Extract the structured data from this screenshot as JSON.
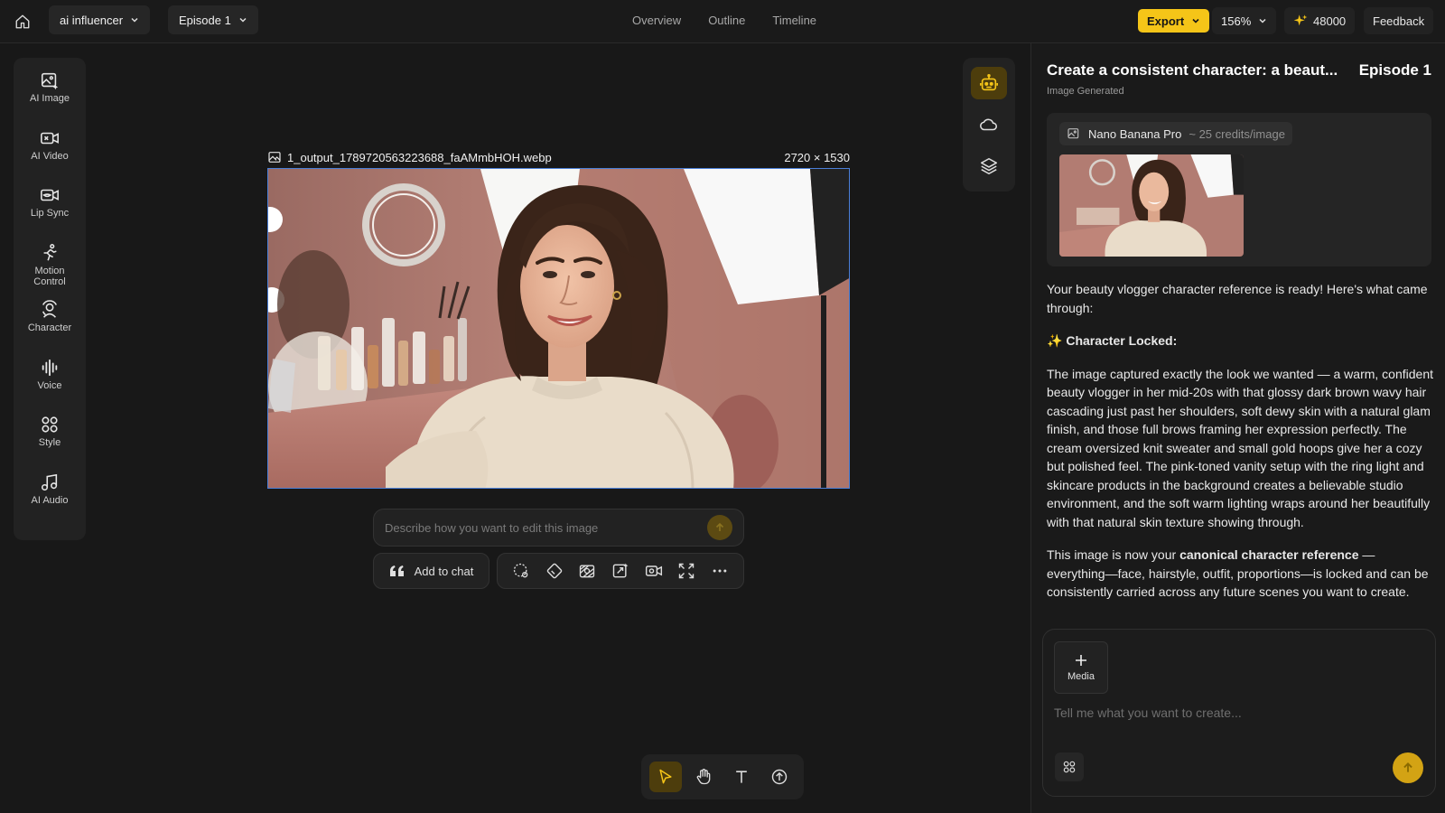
{
  "topbar": {
    "project_name": "ai influencer",
    "episode": "Episode 1",
    "nav": [
      "Overview",
      "Outline",
      "Timeline"
    ],
    "export_label": "Export",
    "zoom": "156%",
    "credits": "48000",
    "feedback_label": "Feedback",
    "accent": "#f5c518"
  },
  "tools": [
    {
      "label": "AI Image",
      "icon": "ai-image-icon"
    },
    {
      "label": "AI Video",
      "icon": "ai-video-icon"
    },
    {
      "label": "Lip Sync",
      "icon": "lip-sync-icon"
    },
    {
      "label": "Motion Control",
      "icon": "motion-control-icon"
    },
    {
      "label": "Character",
      "icon": "character-icon"
    },
    {
      "label": "Voice",
      "icon": "voice-icon"
    },
    {
      "label": "Style",
      "icon": "style-icon"
    },
    {
      "label": "AI Audio",
      "icon": "ai-audio-icon"
    }
  ],
  "canvas": {
    "filename": "1_output_1789720563223688_faAMmbHOH.webp",
    "dimensions": "2720 × 1530",
    "edit_placeholder": "Describe how you want to edit this image",
    "add_to_chat": "Add to chat",
    "actions": [
      "lasso-icon",
      "eraser-icon",
      "background-icon",
      "upscale-icon",
      "to-video-icon",
      "expand-icon",
      "more-icon"
    ]
  },
  "mini_tools": [
    "agent-icon",
    "cloud-icon",
    "layers-icon"
  ],
  "dock": [
    "select-icon",
    "hand-icon",
    "text-icon",
    "upload-icon"
  ],
  "chat": {
    "title": "Create a consistent character: a beaut...",
    "episode": "Episode 1",
    "subtitle": "Image Generated",
    "model": "Nano Banana Pro",
    "model_cost": "~ 25 credits/image",
    "intro": "Your beauty vlogger character reference is ready! Here's what came through:",
    "section_heading": "Character Locked:",
    "description": "The image captured exactly the look we wanted — a warm, confident beauty vlogger in her mid-20s with that glossy dark brown wavy hair cascading just past her shoulders, soft dewy skin with a natural glam finish, and those full brows framing her expression perfectly. The cream oversized knit sweater and small gold hoops give her a cozy but polished feel. The pink-toned vanity setup with the ring light and skincare products in the background creates a believable studio environment, and the soft warm lighting wraps around her beautifully with that natural skin texture showing through.",
    "ref_prefix": "This image is now your ",
    "ref_bold": "canonical character reference",
    "ref_suffix": " — everything—face, hairstyle, outfit, proportions—is locked and can be consistently carried across any future scenes you want to create.",
    "media_label": "Media",
    "composer_placeholder": "Tell me what you want to create..."
  }
}
